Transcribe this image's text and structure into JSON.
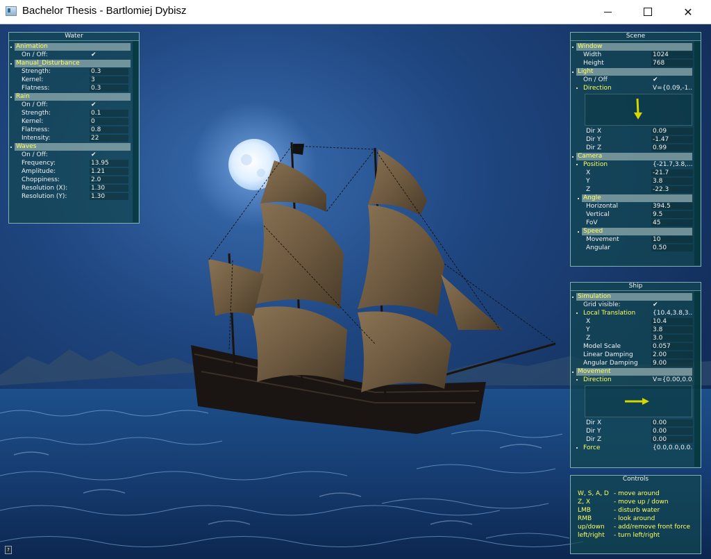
{
  "window": {
    "title": "Bachelor Thesis - Bartlomiej Dybisz",
    "minimize_icon": "minimize-icon",
    "maximize_icon": "maximize-icon",
    "close_icon": "close-icon"
  },
  "water_panel": {
    "title": "Water",
    "sections": [
      {
        "name": "Animation",
        "rows": [
          {
            "label": "On / Off:",
            "check": true
          }
        ]
      },
      {
        "name": "Manual_Disturbance",
        "rows": [
          {
            "label": "Strength:",
            "value": "0.3"
          },
          {
            "label": "Kernel:",
            "value": "3"
          },
          {
            "label": "Flatness:",
            "value": "0.3"
          }
        ]
      },
      {
        "name": "Rain",
        "rows": [
          {
            "label": "On / Off:",
            "check": true
          },
          {
            "label": "Strength:",
            "value": "0.1"
          },
          {
            "label": "Kernel:",
            "value": "0"
          },
          {
            "label": "Flatness:",
            "value": "0.8"
          },
          {
            "label": "Intensity:",
            "value": "22"
          }
        ]
      },
      {
        "name": "Waves",
        "rows": [
          {
            "label": "On / Off:",
            "check": true
          },
          {
            "label": "Frequency:",
            "value": "13.95"
          },
          {
            "label": "Amplitude:",
            "value": "1.21"
          },
          {
            "label": "Choppiness:",
            "value": "2.0"
          },
          {
            "label": "Resolution (X):",
            "value": "1.30"
          },
          {
            "label": "Resolution (Y):",
            "value": "1.30"
          }
        ]
      }
    ]
  },
  "scene_panel": {
    "title": "Scene",
    "window_section": "Window",
    "width_label": "Width",
    "width_value": "1024",
    "height_label": "Height",
    "height_value": "768",
    "light_section": "Light",
    "light_onoff_label": "On / Off",
    "direction_label": "Direction",
    "direction_value": "V={0.09,-1...",
    "dirx_label": "Dir X",
    "dirx_value": "0.09",
    "diry_label": "Dir Y",
    "diry_value": "-1.47",
    "dirz_label": "Dir Z",
    "dirz_value": "0.99",
    "camera_section": "Camera",
    "position_label": "Position",
    "position_value": "{-21.7,3.8,...",
    "x_label": "X",
    "x_value": "-21.7",
    "y_label": "Y",
    "y_value": "3.8",
    "z_label": "Z",
    "z_value": "-22.3",
    "angle_section": "Angle",
    "horizontal_label": "Horizontal",
    "horizontal_value": "394.5",
    "vertical_label": "Vertical",
    "vertical_value": "9.5",
    "fov_label": "FoV",
    "fov_value": "45",
    "speed_section": "Speed",
    "movement_label": "Movement",
    "movement_value": "10",
    "angular_label": "Angular",
    "angular_value": "0.50"
  },
  "ship_panel": {
    "title": "Ship",
    "simulation_section": "Simulation",
    "grid_label": "Grid visible:",
    "local_translation_label": "Local Translation",
    "local_translation_value": "{10.4,3.8,3...",
    "x_label": "X",
    "x_value": "10.4",
    "y_label": "Y",
    "y_value": "3.8",
    "z_label": "Z",
    "z_value": "3.0",
    "model_scale_label": "Model Scale",
    "model_scale_value": "0.057",
    "linear_damping_label": "Linear Damping",
    "linear_damping_value": "2.00",
    "angular_damping_label": "Angular Damping",
    "angular_damping_value": "9.00",
    "movement_section": "Movement",
    "direction_label": "Direction",
    "direction_value": "V={0.00,0.0...",
    "dirx_label": "Dir X",
    "dirx_value": "0.00",
    "diry_label": "Dir Y",
    "diry_value": "0.00",
    "dirz_label": "Dir Z",
    "dirz_value": "0.00",
    "force_label": "Force",
    "force_value": "{0.0,0.0,0.0..."
  },
  "controls_panel": {
    "title": "Controls",
    "items": [
      {
        "key": "W, S, A, D",
        "desc": "-  move around"
      },
      {
        "key": "Z, X",
        "desc": "-  move up / down"
      },
      {
        "key": "LMB",
        "desc": "-  disturb water"
      },
      {
        "key": "RMB",
        "desc": "-  look around"
      },
      {
        "key": "up/down",
        "desc": "-  add/remove front force"
      },
      {
        "key": "left/right",
        "desc": "-  turn left/right"
      }
    ]
  },
  "help_button": "?",
  "colors": {
    "panel_bg": "#124650",
    "section_text": "#ffff60",
    "checkmark": "#c8ff9c",
    "sky": "#1c3a66",
    "sea": "#1b4d8a"
  }
}
